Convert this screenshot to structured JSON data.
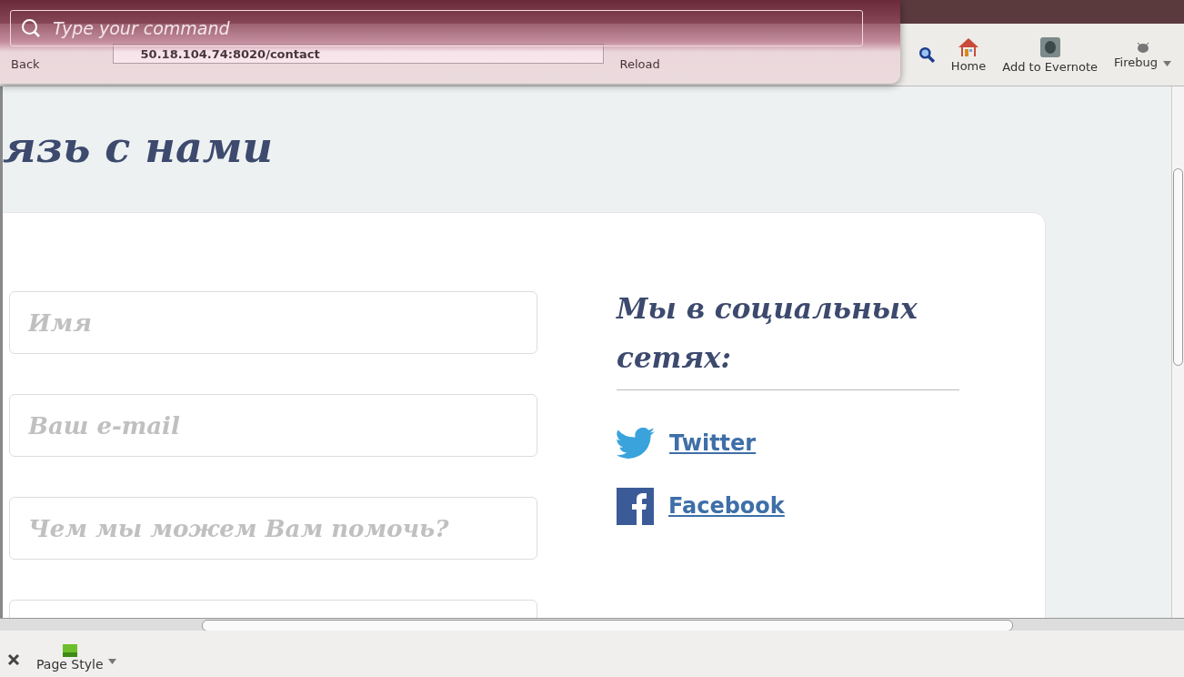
{
  "command_bar": {
    "placeholder": "Type your command"
  },
  "browser": {
    "back_button": {
      "label": "Back"
    },
    "address": "50.18.104.74:8020/contact",
    "reload_button": {
      "label": "Reload"
    },
    "tool_buttons": [
      {
        "kind": "home",
        "label": "Home"
      },
      {
        "kind": "evernote",
        "label": "Add to Evernote"
      },
      {
        "kind": "firebug",
        "label": "Firebug",
        "menu": true
      }
    ]
  },
  "page": {
    "heading": "язь с нами",
    "form_fields": [
      {
        "placeholder": "Имя"
      },
      {
        "placeholder": "Ваш e-mail"
      },
      {
        "placeholder": "Чем мы можем Вам помочь?"
      }
    ],
    "social_heading": "Мы в социальных сетях:",
    "social_links": [
      {
        "kind": "twitter",
        "label": "Twitter"
      },
      {
        "kind": "facebook",
        "label": "Facebook"
      }
    ]
  },
  "addon_bar": {
    "items": [
      {
        "label": "Page Style",
        "menu": true
      }
    ]
  }
}
